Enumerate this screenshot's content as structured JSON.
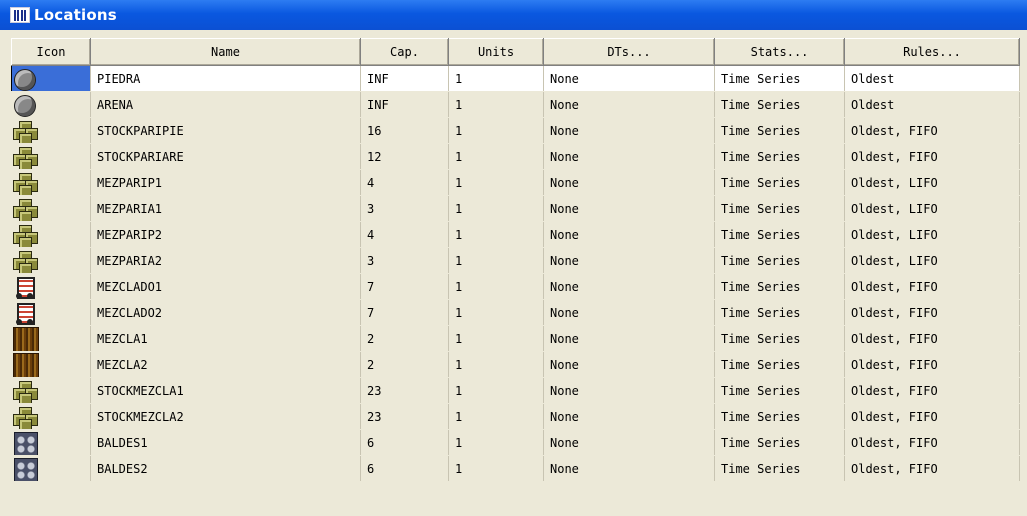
{
  "window": {
    "title": "Locations"
  },
  "columns": {
    "icon": "Icon",
    "name": "Name",
    "cap": "Cap.",
    "units": "Units",
    "dts": "DTs...",
    "stats": "Stats...",
    "rules": "Rules..."
  },
  "rows": [
    {
      "icon": "stone-icon",
      "name": "PIEDRA",
      "cap": "INF",
      "units": "1",
      "dts": "None",
      "stats": "Time Series",
      "rules": "Oldest"
    },
    {
      "icon": "stone-icon",
      "name": "ARENA",
      "cap": "INF",
      "units": "1",
      "dts": "None",
      "stats": "Time Series",
      "rules": "Oldest"
    },
    {
      "icon": "cubes-icon",
      "name": "STOCKPARIPIE",
      "cap": "16",
      "units": "1",
      "dts": "None",
      "stats": "Time Series",
      "rules": "Oldest, FIFO"
    },
    {
      "icon": "cubes-icon",
      "name": "STOCKPARIARE",
      "cap": "12",
      "units": "1",
      "dts": "None",
      "stats": "Time Series",
      "rules": "Oldest, FIFO"
    },
    {
      "icon": "cubes-icon",
      "name": "MEZPARIP1",
      "cap": "4",
      "units": "1",
      "dts": "None",
      "stats": "Time Series",
      "rules": "Oldest, LIFO"
    },
    {
      "icon": "cubes-icon",
      "name": "MEZPARIA1",
      "cap": "3",
      "units": "1",
      "dts": "None",
      "stats": "Time Series",
      "rules": "Oldest, LIFO"
    },
    {
      "icon": "cubes-icon",
      "name": "MEZPARIP2",
      "cap": "4",
      "units": "1",
      "dts": "None",
      "stats": "Time Series",
      "rules": "Oldest, LIFO"
    },
    {
      "icon": "cubes-icon",
      "name": "MEZPARIA2",
      "cap": "3",
      "units": "1",
      "dts": "None",
      "stats": "Time Series",
      "rules": "Oldest, LIFO"
    },
    {
      "icon": "mixer-icon",
      "name": "MEZCLADO1",
      "cap": "7",
      "units": "1",
      "dts": "None",
      "stats": "Time Series",
      "rules": "Oldest, FIFO"
    },
    {
      "icon": "mixer-icon",
      "name": "MEZCLADO2",
      "cap": "7",
      "units": "1",
      "dts": "None",
      "stats": "Time Series",
      "rules": "Oldest, FIFO"
    },
    {
      "icon": "bars-icon",
      "name": "MEZCLA1",
      "cap": "2",
      "units": "1",
      "dts": "None",
      "stats": "Time Series",
      "rules": "Oldest, FIFO"
    },
    {
      "icon": "bars-icon",
      "name": "MEZCLA2",
      "cap": "2",
      "units": "1",
      "dts": "None",
      "stats": "Time Series",
      "rules": "Oldest, FIFO"
    },
    {
      "icon": "cubes-icon",
      "name": "STOCKMEZCLA1",
      "cap": "23",
      "units": "1",
      "dts": "None",
      "stats": "Time Series",
      "rules": "Oldest, FIFO"
    },
    {
      "icon": "cubes-icon",
      "name": "STOCKMEZCLA2",
      "cap": "23",
      "units": "1",
      "dts": "None",
      "stats": "Time Series",
      "rules": "Oldest, FIFO"
    },
    {
      "icon": "bucket-icon",
      "name": "BALDES1",
      "cap": "6",
      "units": "1",
      "dts": "None",
      "stats": "Time Series",
      "rules": "Oldest, FIFO"
    },
    {
      "icon": "bucket-icon",
      "name": "BALDES2",
      "cap": "6",
      "units": "1",
      "dts": "None",
      "stats": "Time Series",
      "rules": "Oldest, FIFO"
    }
  ]
}
